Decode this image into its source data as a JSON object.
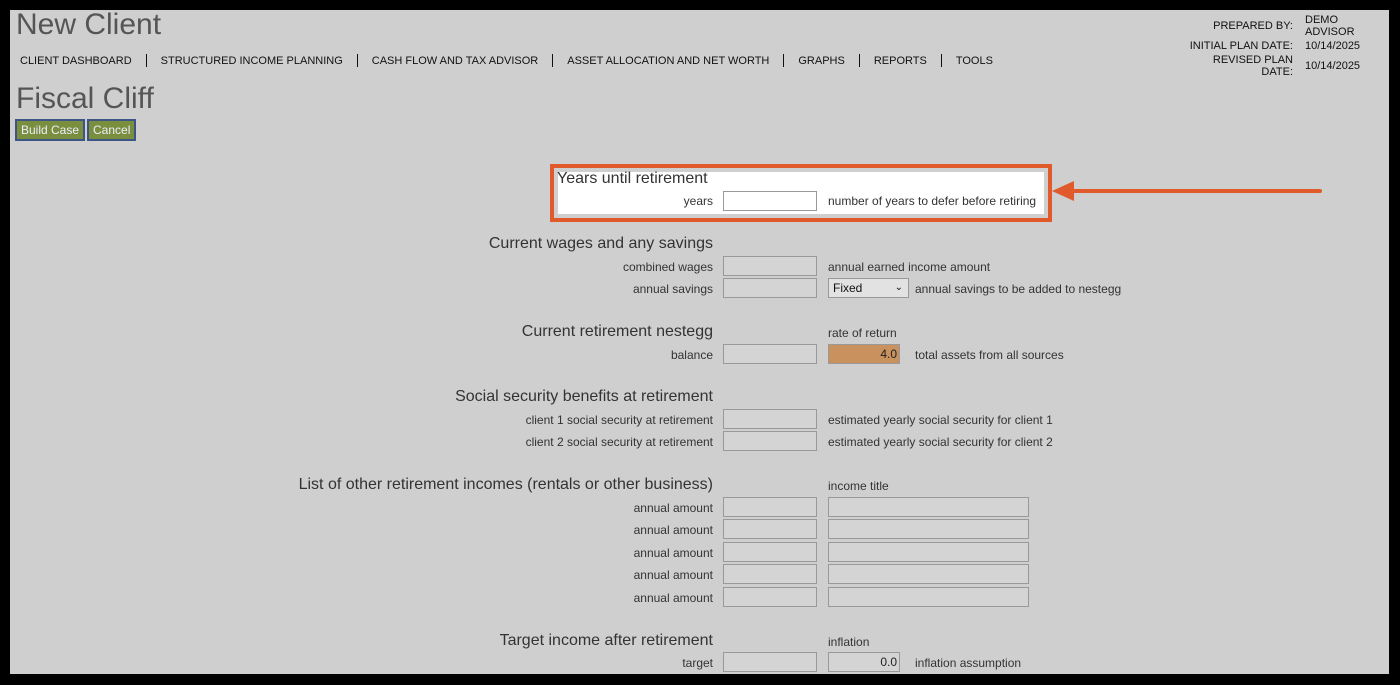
{
  "header": {
    "app_title": "New Client",
    "prepared_by_label": "PREPARED BY:",
    "prepared_by_value": "DEMO ADVISOR",
    "initial_plan_label": "INITIAL PLAN DATE:",
    "initial_plan_value": "10/14/2025",
    "revised_plan_label": "REVISED PLAN DATE:",
    "revised_plan_value": "10/14/2025"
  },
  "nav": [
    "CLIENT DASHBOARD",
    "STRUCTURED INCOME PLANNING",
    "CASH FLOW AND TAX ADVISOR",
    "ASSET ALLOCATION AND NET WORTH",
    "GRAPHS",
    "REPORTS",
    "TOOLS"
  ],
  "page": {
    "title": "Fiscal Cliff",
    "build_case_label": "Build Case",
    "cancel_label": "Cancel"
  },
  "years_section": {
    "title": "Years until retirement",
    "years_label": "years",
    "years_desc": "number of years to defer before retiring"
  },
  "wages_section": {
    "title": "Current wages and any savings",
    "combined_label": "combined wages",
    "combined_desc": "annual earned income amount",
    "savings_label": "annual savings",
    "savings_type": "Fixed",
    "savings_desc": "annual savings to be added to nestegg"
  },
  "nestegg_section": {
    "title": "Current retirement nestegg",
    "rate_header": "rate of return",
    "balance_label": "balance",
    "rate_value": "4.0",
    "balance_desc": "total assets from all sources"
  },
  "ss_section": {
    "title": "Social security benefits at retirement",
    "client1_label": "client 1 social security at retirement",
    "client1_desc": "estimated yearly social security for client 1",
    "client2_label": "client 2 social security at retirement",
    "client2_desc": "estimated yearly social security for client 2"
  },
  "other_section": {
    "title": "List of other retirement incomes (rentals or other business)",
    "income_title_header": "income title",
    "row_labels": [
      "annual amount",
      "annual amount",
      "annual amount",
      "annual amount",
      "annual amount"
    ]
  },
  "target_section": {
    "title": "Target income after retirement",
    "inflation_header": "inflation",
    "target_label": "target",
    "inflation_value": "0.0",
    "inflation_desc": "inflation assumption"
  },
  "colors": {
    "background": "#cfcfcf",
    "button": "#7a8f3e",
    "rate_fill": "#c8915e",
    "highlight": "#e05a2b"
  }
}
